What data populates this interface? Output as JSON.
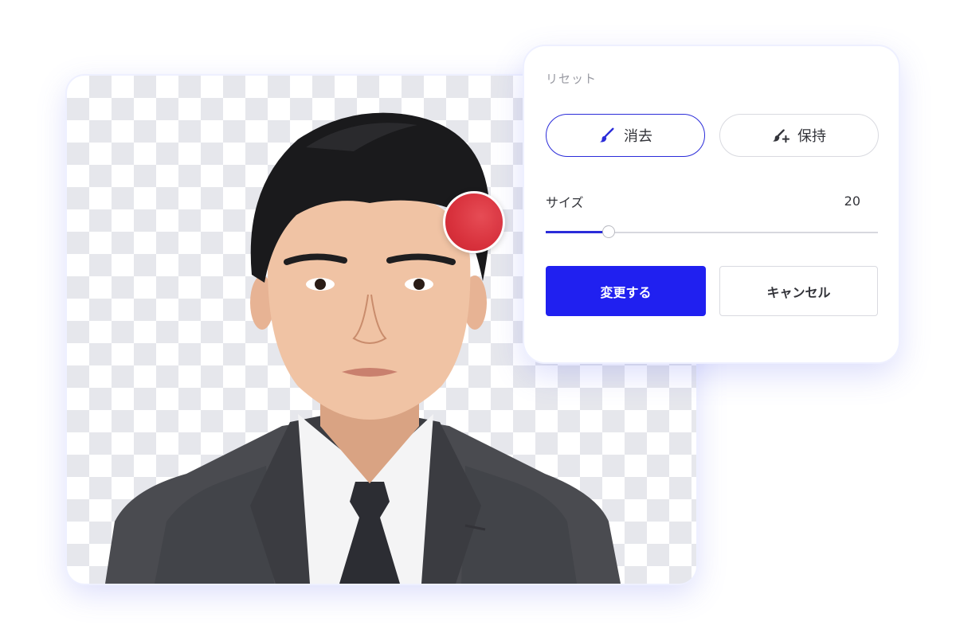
{
  "panel": {
    "reset_label": "リセット",
    "erase_label": "消去",
    "keep_label": "保持",
    "size_label": "サイズ",
    "size_value": "20",
    "size_fraction": 0.19,
    "apply_label": "変更する",
    "cancel_label": "キャンセル"
  },
  "icons": {
    "erase": "brush-icon",
    "keep": "brush-plus-icon"
  },
  "colors": {
    "accent": "#2020f0",
    "brush_cursor": "#d8313c",
    "checker": "#e6e7ec"
  }
}
